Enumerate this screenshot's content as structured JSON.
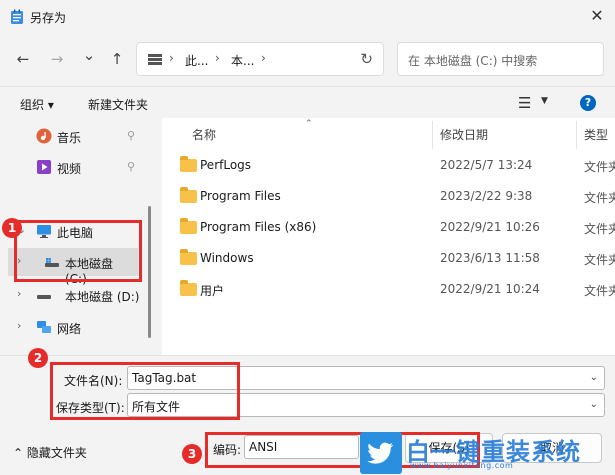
{
  "window": {
    "title": "另存为",
    "close_glyph": "✕"
  },
  "nav": {
    "back_glyph": "←",
    "forward_glyph": "→",
    "history_glyph": "⌄",
    "up_glyph": "↑",
    "address": {
      "segments": [
        "此...",
        "本..."
      ],
      "sep": "›",
      "refresh_glyph": "↻"
    },
    "search_placeholder": "在 本地磁盘 (C:) 中搜索"
  },
  "toolbar": {
    "organize": "组织 ▾",
    "new_folder": "新建文件夹",
    "view_glyph": "☰",
    "view_caret": "▼",
    "help": "?"
  },
  "sidebar": {
    "items": [
      {
        "label": "音乐",
        "pin": "📌"
      },
      {
        "label": "视频",
        "pin": "📌"
      },
      {
        "label": "此电脑",
        "chev": "⌄"
      },
      {
        "label": "本地磁盘 (C:)",
        "chev": "›"
      },
      {
        "label": "本地磁盘 (D:)",
        "chev": "›"
      },
      {
        "label": "网络",
        "chev": "›"
      }
    ]
  },
  "files": {
    "columns": {
      "name": "名称",
      "date": "修改日期",
      "type": "类型",
      "sort_glyph": "⌃"
    },
    "rows": [
      {
        "name": "PerfLogs",
        "date": "2022/5/7 13:24",
        "type": "文件夹"
      },
      {
        "name": "Program Files",
        "date": "2023/2/22 9:38",
        "type": "文件夹"
      },
      {
        "name": "Program Files (x86)",
        "date": "2022/9/21 10:26",
        "type": "文件夹"
      },
      {
        "name": "Windows",
        "date": "2023/6/13 11:58",
        "type": "文件夹"
      },
      {
        "name": "用户",
        "date": "2022/9/21 10:24",
        "type": "文件夹"
      }
    ]
  },
  "form": {
    "filename_label": "文件名(N):",
    "filename_value": "TagTag.bat",
    "savetype_label": "保存类型(T):",
    "savetype_value": "所有文件",
    "encoding_label": "编码:",
    "encoding_value": "ANSI",
    "dropdown_glyph": "⌄"
  },
  "footer": {
    "hide_folders": "⌃  隐藏文件夹",
    "save": "保存(S)",
    "cancel": "取消"
  },
  "annotations": {
    "badge1": "1",
    "badge2": "2",
    "badge3": "3",
    "accent": "#e62b2b"
  },
  "watermark": {
    "text": "白一键重装系统",
    "url": "www.baiyunxitong.com"
  }
}
